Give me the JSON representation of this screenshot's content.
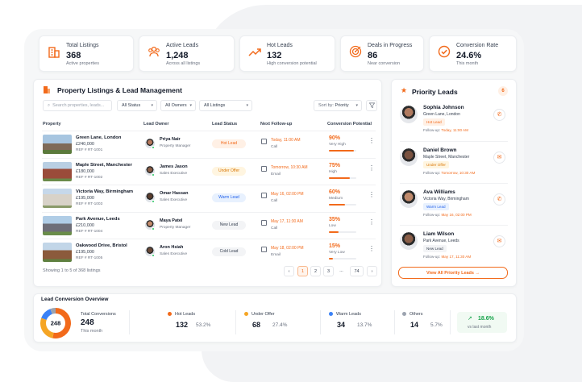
{
  "stats": [
    {
      "label": "Total Listings",
      "value": "368",
      "sub": "Active properties",
      "icon": "building-icon"
    },
    {
      "label": "Active Leads",
      "value": "1,248",
      "sub": "Across all listings",
      "icon": "users-icon"
    },
    {
      "label": "Hot Leads",
      "value": "132",
      "sub": "High conversion potential",
      "icon": "trend-up-icon"
    },
    {
      "label": "Deals in Progress",
      "value": "86",
      "sub": "Near conversion",
      "icon": "target-icon"
    },
    {
      "label": "Conversion Rate",
      "value": "24.6%",
      "sub": "This month",
      "icon": "check-circle-icon"
    }
  ],
  "listings": {
    "title": "Property Listings & Lead Management",
    "search_placeholder": "Search properties, leads...",
    "filters": [
      "All Status",
      "All Owners",
      "All Listings"
    ],
    "sort_label": "Sort by:",
    "sort_value": "Priority",
    "columns": [
      "Property",
      "Lead Owner",
      "Lead Status",
      "Next Follow-up",
      "Conversion Potential"
    ],
    "rows": [
      {
        "address": "Green Lane, London",
        "price": "£240,000",
        "ref": "REF # RT-1001",
        "owner": "Priya Nair",
        "role": "Property Manager",
        "status": "Hot Lead",
        "date": "Today, 11:00 AM",
        "method": "Call",
        "pct": "90%",
        "level": "Very High",
        "progress": 0.9
      },
      {
        "address": "Maple Street, Manchester",
        "price": "£180,000",
        "ref": "REF # RT-1002",
        "owner": "James Jason",
        "role": "Sales Executive",
        "status": "Under Offer",
        "date": "Tomorrow, 10:30 AM",
        "method": "Email",
        "pct": "75%",
        "level": "High",
        "progress": 0.75
      },
      {
        "address": "Victoria Way, Birmingham",
        "price": "£195,000",
        "ref": "REF # RT-1003",
        "owner": "Omar Hassan",
        "role": "Sales Executive",
        "status": "Warm Lead",
        "date": "May 16, 02:00 PM",
        "method": "Call",
        "pct": "60%",
        "level": "Medium",
        "progress": 0.6
      },
      {
        "address": "Park Avenue, Leeds",
        "price": "£210,000",
        "ref": "REF # RT-1004",
        "owner": "Maya Patel",
        "role": "Property Manager",
        "status": "New Lead",
        "date": "May 17, 11:30 AM",
        "method": "Call",
        "pct": "35%",
        "level": "Low",
        "progress": 0.35
      },
      {
        "address": "Oakwood Drive, Bristol",
        "price": "£195,000",
        "ref": "REF # RT-1005",
        "owner": "Aron Hsiah",
        "role": "Sales Executive",
        "status": "Cold Lead",
        "date": "May 18, 02:00 PM",
        "method": "Email",
        "pct": "15%",
        "level": "Very Low",
        "progress": 0.15
      }
    ],
    "showing": "Showing 1 to 5 of 368 listings",
    "pages": [
      "1",
      "2",
      "3",
      "...",
      "74"
    ]
  },
  "priority": {
    "title": "Priority Leads",
    "count": "6",
    "leads": [
      {
        "name": "Sophia Johnson",
        "address": "Green Lane, London",
        "tag": "Hot Lead",
        "followup": "Follow-up:",
        "time": "Today, 11:00 AM",
        "action": "phone-icon"
      },
      {
        "name": "Daniel Brown",
        "address": "Maple Street, Manchester",
        "tag": "Under Offer",
        "followup": "Follow-up:",
        "time": "Tomorrow, 10:30 AM",
        "action": "mail-icon"
      },
      {
        "name": "Ava Williams",
        "address": "Victoria Way, Birmingham",
        "tag": "Warm Lead",
        "followup": "Follow-up:",
        "time": "May 16, 02:00 PM",
        "action": "phone-icon"
      },
      {
        "name": "Liam Wilson",
        "address": "Park Avenue, Leeds",
        "tag": "New Lead",
        "followup": "Follow-up:",
        "time": "May 17, 11:30 AM",
        "action": "mail-icon"
      }
    ],
    "view_all": "View All Priority Leads"
  },
  "overview": {
    "title": "Lead Conversion Overview",
    "donut_value": "248",
    "total_label": "Total Conversions",
    "total_value": "248",
    "total_sub": "This month",
    "segments": [
      {
        "label": "Hot Leads",
        "value": "132",
        "pct": "53.2%",
        "color": "#f26a1b",
        "share": 0.532
      },
      {
        "label": "Under Offer",
        "value": "68",
        "pct": "27.4%",
        "color": "#f5a524",
        "share": 0.274
      },
      {
        "label": "Warm Leads",
        "value": "34",
        "pct": "13.7%",
        "color": "#3b82f6",
        "share": 0.137
      },
      {
        "label": "Others",
        "value": "14",
        "pct": "5.7%",
        "color": "#9ca3af",
        "share": 0.057
      }
    ],
    "growth": "18.6%",
    "growth_sub": "vs last month"
  }
}
